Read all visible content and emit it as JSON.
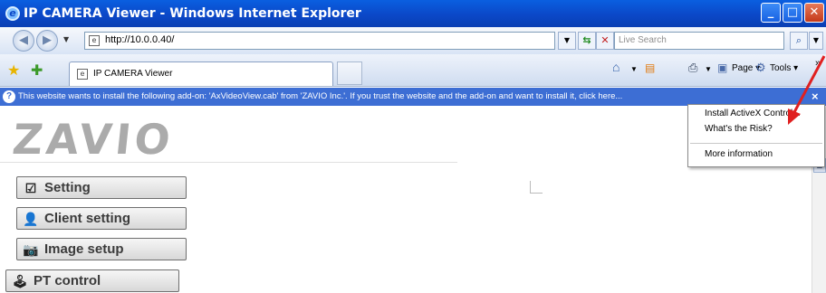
{
  "window": {
    "title": "IP CAMERA Viewer - Windows Internet Explorer",
    "min": "_",
    "max": "□",
    "close": "✕"
  },
  "address_bar": {
    "url": "http://10.0.0.40/",
    "search_placeholder": "Live Search"
  },
  "tab": {
    "label": "IP CAMERA Viewer"
  },
  "toolbar": {
    "page_label": "Page ▾",
    "tools_label": "Tools ▾",
    "more": "»"
  },
  "info_bar": {
    "message": "This website wants to install the following add-on: 'AxVideoView.cab' from 'ZAVIO Inc.'. If you trust the website and the add-on and want to install it, click here...",
    "close": "×"
  },
  "popup_menu": {
    "items": [
      "Install ActiveX Control...",
      "What's the Risk?",
      "More information"
    ]
  },
  "content": {
    "logo": "ZAVIO",
    "menu": [
      "Setting",
      "Client setting",
      "Image setup",
      "PT control"
    ]
  },
  "icons": {
    "setting": "checkbox-icon",
    "client": "user-icon",
    "image": "camera-icon",
    "pt": "joystick-icon"
  },
  "colors": {
    "title_bar": "#0b48c8",
    "info_bar": "#3d6ed4",
    "logo": "#ababab",
    "arrow": "#e02020"
  }
}
